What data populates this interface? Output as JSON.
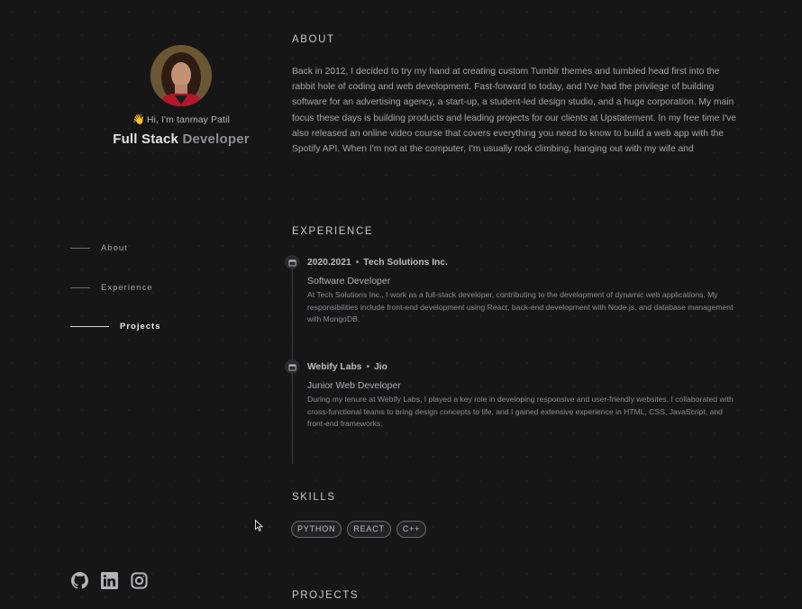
{
  "profile": {
    "greeting_emoji": "👋",
    "greeting": "Hi, I'm tanmay Patil",
    "role_part1": "Full Stack",
    "role_part2": "Developer"
  },
  "nav": {
    "items": [
      {
        "label": "About",
        "active": false
      },
      {
        "label": "Experience",
        "active": false
      },
      {
        "label": "Projects",
        "active": true
      }
    ]
  },
  "socials": [
    "github-icon",
    "linkedin-icon",
    "instagram-icon"
  ],
  "about": {
    "title": "ABOUT",
    "text": "Back in 2012, I decided to try my hand at creating custom Tumblr themes and tumbled head first into the rabbit hole of coding and web development. Fast-forward to today, and I've had the privilege of building software for an advertising agency, a start-up, a student-led design studio, and a huge corporation. My main focus these days is building products and leading projects for our clients at Upstatement. In my free time I've also released an online video course that covers everything you need to know to build a web app with the Spotify API. When I'm not at the computer, I'm usually rock climbing, hanging out with my wife and"
  },
  "experience": {
    "title": "EXPERIENCE",
    "jobs": [
      {
        "period": "2020.2021",
        "company": "Tech Solutions Inc.",
        "position": "Software Developer",
        "description": "At Tech Solutions Inc., I work as a full-stack developer, contributing to the development of dynamic web applications. My responsibilities include front-end development using React, back-end development with Node.js, and database management with MongoDB."
      },
      {
        "period": "Webify Labs",
        "company": "Jio",
        "position": "Junior Web Developer",
        "description": "During my tenure at Webify Labs, I played a key role in developing responsive and user-friendly websites. I collaborated with cross-functional teams to bring design concepts to life, and I gained extensive experience in HTML, CSS, JavaScript, and front-end frameworks."
      }
    ]
  },
  "skills": {
    "title": "SKILLS",
    "items": [
      "PYTHON",
      "REACT",
      "C++"
    ]
  },
  "projects": {
    "title": "PROJECTS"
  },
  "colors": {
    "background": "#161617",
    "accent": "#e3e3e6",
    "muted": "#8f8f95"
  }
}
